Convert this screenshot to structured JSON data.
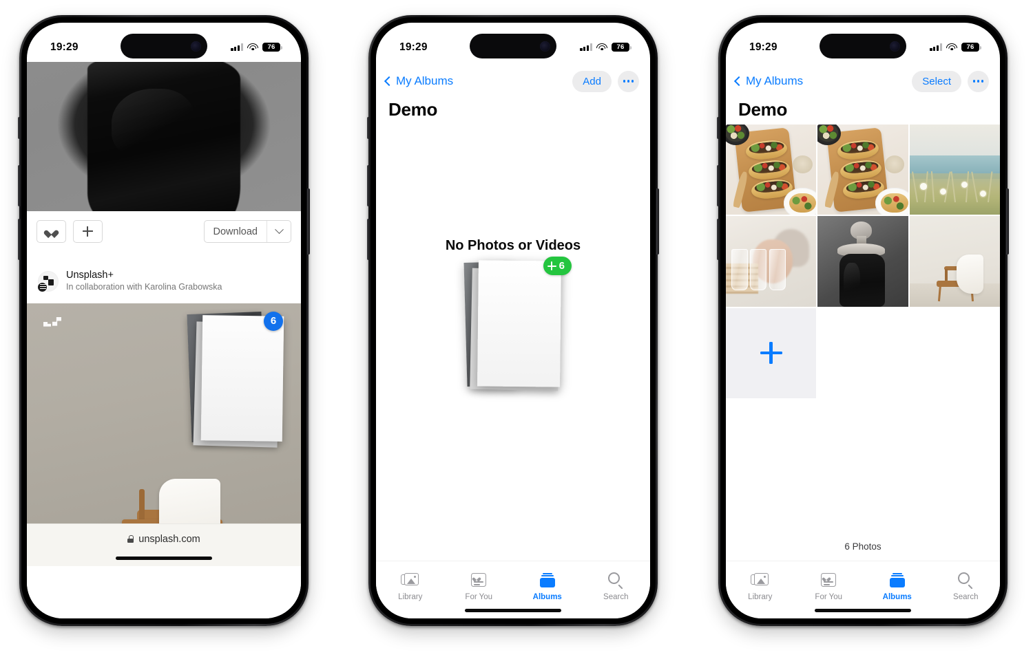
{
  "status_bar": {
    "time": "19:29",
    "battery_percent": "76",
    "signal_icon": "signal-bars-icon",
    "wifi_icon": "wifi-icon"
  },
  "phone1": {
    "name": "safari-unsplash",
    "actions": {
      "like_icon": "heart-icon",
      "add_icon": "plus-icon",
      "download_label": "Download",
      "caret_icon": "chevron-down-icon"
    },
    "author": {
      "name": "Unsplash+",
      "subtitle": "In collaboration with Karolina Grabowska",
      "avatar_icon": "unsplash-avatar-icon"
    },
    "drag": {
      "count": "6",
      "badge_icon": "drag-count-badge"
    },
    "browser": {
      "lock_icon": "lock-icon",
      "url": "unsplash.com"
    }
  },
  "phone2": {
    "name": "photos-album-empty",
    "nav": {
      "back_icon": "chevron-left-icon",
      "back_label": "My Albums",
      "add_label": "Add",
      "more_icon": "ellipsis-icon"
    },
    "title": "Demo",
    "empty": {
      "title": "No Photos or Videos",
      "drop_plus_icon": "plus-icon",
      "drop_count": "6"
    },
    "tabs": [
      {
        "label": "Library",
        "icon": "library-icon",
        "active": false
      },
      {
        "label": "For You",
        "icon": "for-you-icon",
        "active": false
      },
      {
        "label": "Albums",
        "icon": "albums-icon",
        "active": true
      },
      {
        "label": "Search",
        "icon": "search-icon",
        "active": false
      }
    ]
  },
  "phone3": {
    "name": "photos-album-filled",
    "nav": {
      "back_icon": "chevron-left-icon",
      "back_label": "My Albums",
      "select_label": "Select",
      "more_icon": "ellipsis-icon"
    },
    "title": "Demo",
    "photos": [
      {
        "alt": "tacos-on-wooden-board"
      },
      {
        "alt": "tacos-on-wooden-board-duplicate"
      },
      {
        "alt": "coastal-ocean-with-wildflowers"
      },
      {
        "alt": "drinking-glasses-with-portrait"
      },
      {
        "alt": "black-and-white-woman-in-dress"
      },
      {
        "alt": "wooden-chair-with-white-cloth"
      }
    ],
    "add_tile": {
      "icon": "plus-icon"
    },
    "footer_count": "6 Photos",
    "tabs": [
      {
        "label": "Library",
        "icon": "library-icon",
        "active": false
      },
      {
        "label": "For You",
        "icon": "for-you-icon",
        "active": false
      },
      {
        "label": "Albums",
        "icon": "albums-icon",
        "active": true
      },
      {
        "label": "Search",
        "icon": "search-icon",
        "active": false
      }
    ]
  },
  "colors": {
    "accent_blue": "#0a7cff",
    "badge_green": "#24c53f",
    "badge_blue": "#1271ec"
  }
}
